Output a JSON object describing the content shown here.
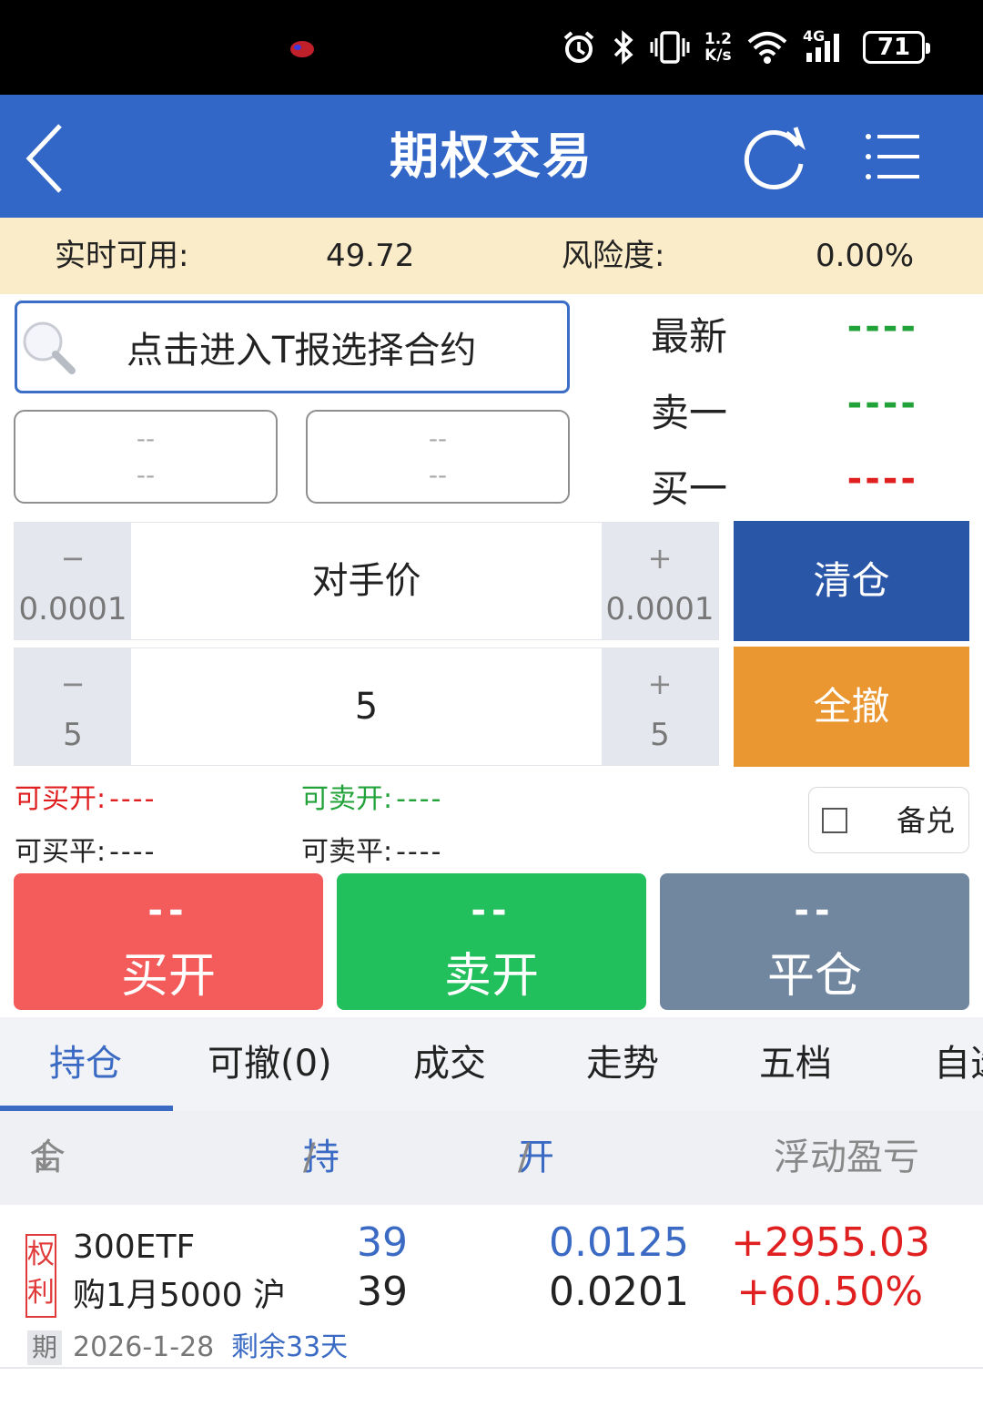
{
  "status_bar": {
    "net_speed_value": "1.2",
    "net_speed_unit": "K/s",
    "network": "4G",
    "battery": "71"
  },
  "nav": {
    "title": "期权交易"
  },
  "info": {
    "available_label": "实时可用:",
    "available_value": "49.72",
    "risk_label": "风险度:",
    "risk_value": "0.00%"
  },
  "contract": {
    "search_placeholder": "点击进入T报选择合约",
    "box_left_line1": "--",
    "box_left_line2": "--",
    "box_right_line1": "--",
    "box_right_line2": "--"
  },
  "quote": {
    "latest_label": "最新",
    "latest_value": "----",
    "ask1_label": "卖一",
    "ask1_value": "----",
    "bid1_label": "买一",
    "bid1_value": "----",
    "colors": {
      "latest": "#22a33a",
      "ask1": "#22a33a",
      "bid1": "#e02020"
    }
  },
  "price_stepper": {
    "minus_symbol": "−",
    "minus_step": "0.0001",
    "value": "对手价",
    "plus_symbol": "+",
    "plus_step": "0.0001"
  },
  "qty_stepper": {
    "minus_symbol": "−",
    "minus_step": "5",
    "value": "5",
    "plus_symbol": "+",
    "plus_step": "5"
  },
  "actions": {
    "clear_label": "清仓",
    "cancel_all_label": "全撤",
    "clear_color": "#2a56a8",
    "cancel_all_color": "#ea9631"
  },
  "availability": {
    "buy_open_label": "可买开:",
    "buy_open_value": "----",
    "sell_open_label": "可卖开:",
    "sell_open_value": "----",
    "buy_close_label": "可买平:",
    "buy_close_value": "----",
    "sell_close_label": "可卖平:",
    "sell_close_value": "----"
  },
  "reserve": {
    "label": "备兑",
    "checked": false
  },
  "trade_buttons": {
    "buy_open_price": "--",
    "buy_open_label": "买开",
    "sell_open_price": "--",
    "sell_open_label": "卖开",
    "close_price": "--",
    "close_label": "平仓",
    "buy_color": "#f45c5c",
    "sell_color": "#22bf5d",
    "close_color": "#7187a0"
  },
  "tabs": [
    {
      "label": "持仓",
      "active": true
    },
    {
      "label": "可撤(0)",
      "active": false
    },
    {
      "label": "成交",
      "active": false
    },
    {
      "label": "走势",
      "active": false
    },
    {
      "label": "五档",
      "active": false
    },
    {
      "label": "自选",
      "active": false
    }
  ],
  "table": {
    "col_contract": "合约",
    "col_sort_icon": "↓",
    "col_position_a": "持仓",
    "col_position_b": "/可用",
    "col_price_a": "开仓价",
    "col_price_b": "/现价",
    "col_pnl": "浮动盈亏",
    "rows": [
      {
        "tag_line1": "权",
        "tag_line2": "利",
        "name_line1": "300ETF",
        "name_line2": "购1月5000 沪",
        "position": "39",
        "available": "39",
        "open_price": "0.0125",
        "current_price": "0.0201",
        "pnl_amount": "+2955.03",
        "pnl_percent": "+60.50%",
        "expiry_tag": "期",
        "expiry_date": "2026-1-28",
        "days_left": "剩余33天"
      }
    ]
  }
}
